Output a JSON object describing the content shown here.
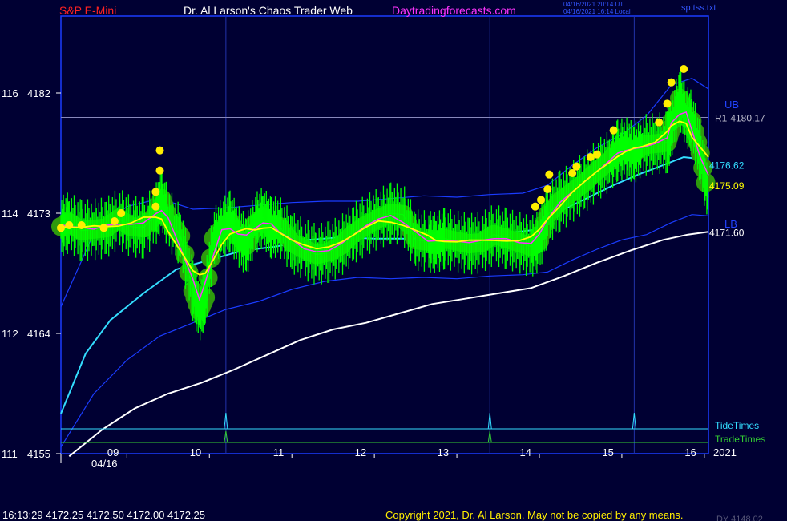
{
  "header": {
    "instrument": "S&P E-Mini",
    "site": "Dr. Al Larson's Chaos Trader Web",
    "link": "Daytradingforecasts.com",
    "timestamp_utc": "04/16/2021 20:14 UT",
    "timestamp_local": "04/16/2021 16:14 Local",
    "file": "sp.tss.txt"
  },
  "footer": {
    "quote": "16:13:29  4172.25 4172.50 4172.00 4172.25",
    "copyright": "Copyright 2021, Dr. Al Larson. May not be copied by any means.",
    "partial": "DY 4148.02"
  },
  "colors": {
    "background": "#000033",
    "frame": "#1a3cff",
    "price": "#00ff00",
    "bubble": "#2e9a0d",
    "yellow_dots": "#ffee00",
    "magenta_line": "#ff33ff",
    "yellow_line": "#ffff00",
    "cyan_line": "#33ddff",
    "white_line": "#ffffff",
    "band": "#1a3cff",
    "r1_line": "#8888bb",
    "tide_times": "#33ddff",
    "trade_times": "#33cc33",
    "instrument_text": "#ff2222",
    "link_text": "#ff33ff"
  },
  "chart_data": {
    "type": "line",
    "title": "S&P E-Mini",
    "x_tick_labels": [
      "09",
      "10",
      "11",
      "12",
      "13",
      "14",
      "15",
      "16"
    ],
    "date_label": "04/16",
    "year_label": "2021",
    "y_ticks": [
      {
        "left": "116",
        "right": "4182",
        "value": 4182
      },
      {
        "left": "114",
        "right": "4173",
        "value": 4173
      },
      {
        "left": "112",
        "right": "4164",
        "value": 4164
      },
      {
        "left": "111",
        "right": "4155",
        "value": 4155
      }
    ],
    "ylim": [
      4155,
      4182
    ],
    "xlim": [
      8.2,
      16.05
    ],
    "level_lines": [
      {
        "label": "R1-4180.17",
        "value": 4180.17
      }
    ],
    "end_labels": {
      "ub": "UB",
      "lb": "LB",
      "cyan": "4176.62",
      "yellow": "4175.09",
      "white": "4171.60"
    },
    "timing_lines": {
      "tide_label": "TideTimes",
      "trade_label": "TradeTimes",
      "tide_spikes": [
        10.2,
        13.4,
        15.15
      ],
      "trade_spikes": [
        10.2,
        13.4
      ]
    },
    "series": [
      {
        "name": "price",
        "x": [
          8.2,
          8.3,
          8.45,
          8.6,
          8.75,
          8.9,
          9.05,
          9.2,
          9.35,
          9.42,
          9.5,
          9.65,
          9.8,
          9.88,
          9.95,
          10.05,
          10.15,
          10.25,
          10.35,
          10.45,
          10.55,
          10.65,
          10.75,
          10.85,
          11.0,
          11.15,
          11.3,
          11.45,
          11.6,
          11.75,
          11.9,
          12.05,
          12.2,
          12.35,
          12.5,
          12.65,
          12.75,
          12.85,
          13.0,
          13.15,
          13.3,
          13.45,
          13.6,
          13.75,
          13.9,
          14.0,
          14.1,
          14.25,
          14.4,
          14.55,
          14.7,
          14.85,
          14.95,
          15.05,
          15.15,
          15.25,
          15.4,
          15.55,
          15.6,
          15.7,
          15.78,
          15.85,
          15.95,
          16.05
        ],
        "y": [
          4172.0,
          4172.3,
          4171.7,
          4171.8,
          4171.9,
          4172.6,
          4172.0,
          4171.9,
          4172.9,
          4174.1,
          4172.6,
          4171.3,
          4167.2,
          4165.7,
          4166.7,
          4171.1,
          4171.8,
          4172.4,
          4171.3,
          4170.6,
          4172.2,
          4172.7,
          4171.9,
          4172.0,
          4170.8,
          4170.3,
          4169.9,
          4170.1,
          4170.6,
          4171.5,
          4172.1,
          4172.6,
          4173.0,
          4172.9,
          4171.0,
          4170.9,
          4170.8,
          4171.1,
          4170.9,
          4170.7,
          4170.8,
          4171.4,
          4171.1,
          4170.8,
          4170.5,
          4170.9,
          4172.9,
          4173.9,
          4174.6,
          4175.3,
          4176.2,
          4176.9,
          4177.7,
          4177.9,
          4177.5,
          4178.1,
          4178.2,
          4178.3,
          4179.4,
          4181.6,
          4180.2,
          4179.9,
          4177.5,
          4174.2
        ]
      },
      {
        "name": "cyan",
        "x": [
          8.2,
          8.5,
          8.8,
          9.2,
          9.6,
          10.0,
          10.4,
          10.8,
          11.2,
          11.6,
          12.0,
          12.4,
          12.8,
          13.2,
          13.6,
          14.0,
          14.3,
          14.6,
          14.9,
          15.2,
          15.5,
          15.75,
          15.9,
          16.05
        ],
        "y": [
          4158.0,
          4162.5,
          4165.0,
          4167.0,
          4168.8,
          4169.5,
          4170.2,
          4170.5,
          4171.0,
          4171.2,
          4171.1,
          4171.1,
          4171.2,
          4171.4,
          4171.5,
          4171.8,
          4173.3,
          4174.2,
          4175.1,
          4175.9,
          4176.6,
          4177.2,
          4177.1,
          4176.62
        ]
      },
      {
        "name": "white",
        "x": [
          8.3,
          8.7,
          9.1,
          9.5,
          9.9,
          10.3,
          10.7,
          11.1,
          11.5,
          11.9,
          12.3,
          12.7,
          13.1,
          13.5,
          13.9,
          14.3,
          14.7,
          15.1,
          15.5,
          15.8,
          16.05
        ],
        "y": [
          4154.8,
          4156.8,
          4158.4,
          4159.5,
          4160.3,
          4161.3,
          4162.4,
          4163.5,
          4164.3,
          4164.8,
          4165.5,
          4166.2,
          4166.6,
          4167.0,
          4167.4,
          4168.3,
          4169.3,
          4170.2,
          4171.0,
          4171.4,
          4171.6
        ]
      },
      {
        "name": "upper-band",
        "x": [
          8.2,
          8.6,
          9.0,
          9.4,
          9.8,
          10.2,
          10.6,
          11.0,
          11.4,
          11.8,
          12.2,
          12.6,
          13.0,
          13.4,
          13.8,
          14.1,
          14.4,
          14.7,
          15.0,
          15.3,
          15.6,
          15.85,
          16.05
        ],
        "y": [
          4166.0,
          4171.5,
          4173.5,
          4174.1,
          4173.3,
          4173.4,
          4173.6,
          4173.8,
          4173.9,
          4173.9,
          4174.1,
          4174.3,
          4174.2,
          4174.4,
          4174.5,
          4175.1,
          4176.6,
          4177.9,
          4178.9,
          4180.3,
          4182.6,
          4183.1,
          4182.3
        ]
      },
      {
        "name": "lower-band",
        "x": [
          8.2,
          8.6,
          9.0,
          9.4,
          9.8,
          10.2,
          10.6,
          11.0,
          11.4,
          11.8,
          12.2,
          12.6,
          13.0,
          13.4,
          13.8,
          14.1,
          14.4,
          14.7,
          15.0,
          15.3,
          15.6,
          15.85,
          16.05
        ],
        "y": [
          4155.5,
          4159.5,
          4162.0,
          4163.8,
          4164.8,
          4165.8,
          4166.4,
          4167.3,
          4167.9,
          4168.2,
          4168.1,
          4168.2,
          4168.1,
          4168.3,
          4168.4,
          4168.6,
          4169.5,
          4170.3,
          4171.0,
          4171.4,
          4172.3,
          4172.9,
          4172.8
        ]
      }
    ],
    "yellow_dots": [
      {
        "x": 8.2,
        "y": 4171.9
      },
      {
        "x": 8.3,
        "y": 4172.1
      },
      {
        "x": 8.45,
        "y": 4172.1
      },
      {
        "x": 8.72,
        "y": 4171.9
      },
      {
        "x": 8.85,
        "y": 4172.4
      },
      {
        "x": 8.93,
        "y": 4173.0
      },
      {
        "x": 9.35,
        "y": 4173.5
      },
      {
        "x": 9.35,
        "y": 4174.6
      },
      {
        "x": 9.4,
        "y": 4176.2
      },
      {
        "x": 9.4,
        "y": 4177.7
      },
      {
        "x": 13.95,
        "y": 4173.5
      },
      {
        "x": 14.02,
        "y": 4174.0
      },
      {
        "x": 14.1,
        "y": 4174.8
      },
      {
        "x": 14.12,
        "y": 4175.9
      },
      {
        "x": 14.4,
        "y": 4176.0
      },
      {
        "x": 14.45,
        "y": 4176.5
      },
      {
        "x": 14.62,
        "y": 4177.2
      },
      {
        "x": 14.7,
        "y": 4177.4
      },
      {
        "x": 14.9,
        "y": 4179.2
      },
      {
        "x": 15.45,
        "y": 4179.8
      },
      {
        "x": 15.55,
        "y": 4181.2
      },
      {
        "x": 15.6,
        "y": 4182.8
      },
      {
        "x": 15.75,
        "y": 4183.8
      }
    ]
  }
}
